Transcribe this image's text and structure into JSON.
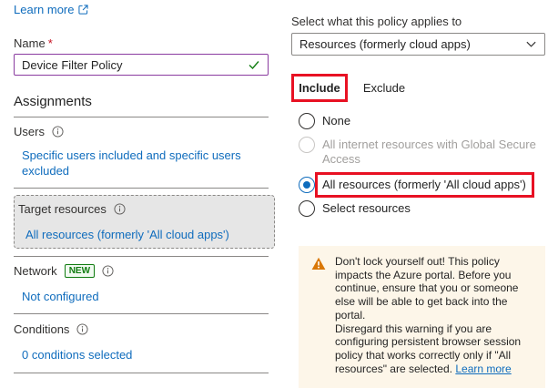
{
  "header": {
    "learn_more": "Learn more"
  },
  "name_field": {
    "label": "Name",
    "required_mark": "*",
    "value": "Device Filter Policy"
  },
  "assignments": {
    "title": "Assignments",
    "users": {
      "label": "Users",
      "link": "Specific users included and specific users excluded"
    },
    "target_resources": {
      "label": "Target resources",
      "link": "All resources (formerly 'All cloud apps')"
    },
    "network": {
      "label": "Network",
      "badge": "NEW",
      "link": "Not configured"
    },
    "conditions": {
      "label": "Conditions",
      "link": "0 conditions selected"
    }
  },
  "applies_to": {
    "label": "Select what this policy applies to",
    "selected": "Resources (formerly cloud apps)"
  },
  "tabs": {
    "include": "Include",
    "exclude": "Exclude"
  },
  "options": [
    {
      "label": "None",
      "state": "unchecked"
    },
    {
      "label": "All internet resources with Global Secure Access",
      "state": "disabled"
    },
    {
      "label": "All resources (formerly 'All cloud apps')",
      "state": "checked"
    },
    {
      "label": "Select resources",
      "state": "unchecked"
    }
  ],
  "warning": {
    "text1": "Don't lock yourself out! This policy impacts the Azure portal. Before you continue, ensure that you or someone else will be able to get back into the portal.",
    "text2": "Disregard this warning if you are configuring persistent browser session policy that works correctly only if \"All resources\" are selected.",
    "link": "Learn more"
  },
  "colors": {
    "accent": "#0f6cbd",
    "highlight": "#e81123",
    "warning_bg": "#fdf6e9",
    "warning_icon": "#d97706",
    "badge_green": "#107c10"
  },
  "icons": [
    "external-link-icon",
    "checkmark-icon",
    "info-icon",
    "chevron-down-icon",
    "warning-icon"
  ]
}
